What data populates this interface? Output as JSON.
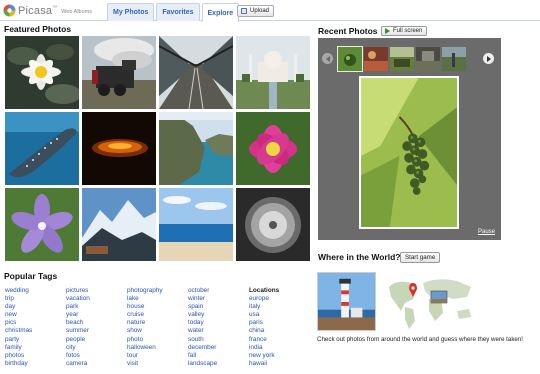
{
  "header": {
    "logo_text": "Picasa",
    "logo_tm": "™",
    "logo_sub": "Web Albums",
    "tabs": [
      {
        "label": "My Photos",
        "active": false
      },
      {
        "label": "Favorites",
        "active": false
      },
      {
        "label": "Explore",
        "active": true
      }
    ],
    "upload_label": "Upload"
  },
  "featured": {
    "title": "Featured Photos"
  },
  "tags": {
    "title": "Popular Tags",
    "columns": [
      [
        "wedding",
        "trip",
        "day",
        "new",
        "pics",
        "christmas",
        "party",
        "family",
        "photos",
        "birthday"
      ],
      [
        "pictures",
        "vacation",
        "park",
        "year",
        "beach",
        "summer",
        "people",
        "city",
        "fotos",
        "camera"
      ],
      [
        "photography",
        "lake",
        "house",
        "cruise",
        "nature",
        "show",
        "photo",
        "halloween",
        "tour",
        "visit"
      ],
      [
        "october",
        "winter",
        "spain",
        "valley",
        "today",
        "water",
        "south",
        "december",
        "fall",
        "landscape"
      ]
    ],
    "locations_label": "Locations",
    "locations": [
      "europe",
      "italy",
      "usa",
      "paris",
      "china",
      "france",
      "india",
      "new york",
      "hawaii"
    ]
  },
  "recent": {
    "title": "Recent Photos",
    "fullscreen_label": "Full screen",
    "pause_label": "Pause"
  },
  "world": {
    "title": "Where in the World?",
    "start_label": "Start game",
    "description": "Check out photos from around the world and guess where they were taken!"
  },
  "colors": {
    "link": "#2a54b5",
    "tab_text": "#3366bb",
    "viewer_bg": "#6b6b6b"
  }
}
